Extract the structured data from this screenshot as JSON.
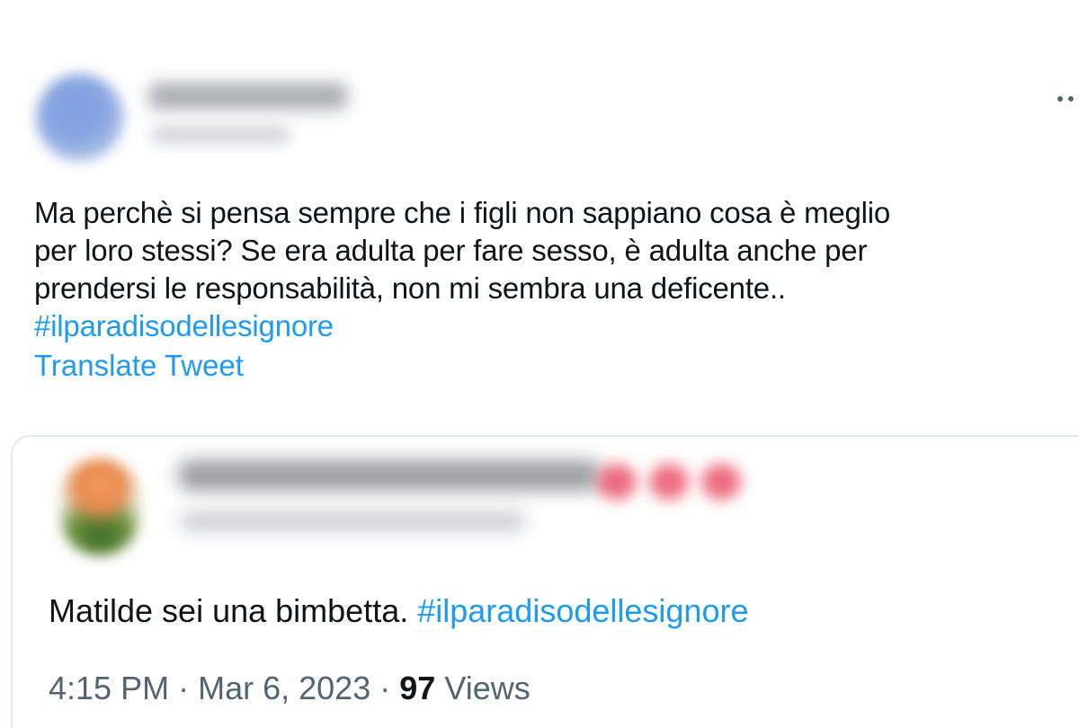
{
  "main_tweet": {
    "lines": [
      "Ma perchè si pensa sempre che i figli non sappiano cosa è meglio",
      "per loro stessi? Se era adulta per fare sesso, è adulta anche per",
      "prendersi le responsabilità, non mi sembra una deficente.."
    ],
    "hashtag": "#ilparadisodellesignore",
    "translate_label": "Translate Tweet",
    "more_icon": "more-horizontal-icon"
  },
  "quoted_tweet": {
    "text": "Matilde sei una bimbetta.",
    "hashtag": "#ilparadisodellesignore"
  },
  "meta": {
    "time": "4:15 PM",
    "separator": "·",
    "date": "Mar 6, 2023",
    "views_count": "97",
    "views_label": "Views"
  },
  "colors": {
    "text": "#0f1419",
    "link": "#1d9bf0",
    "secondary": "#536471",
    "border": "#e4e8ec"
  }
}
